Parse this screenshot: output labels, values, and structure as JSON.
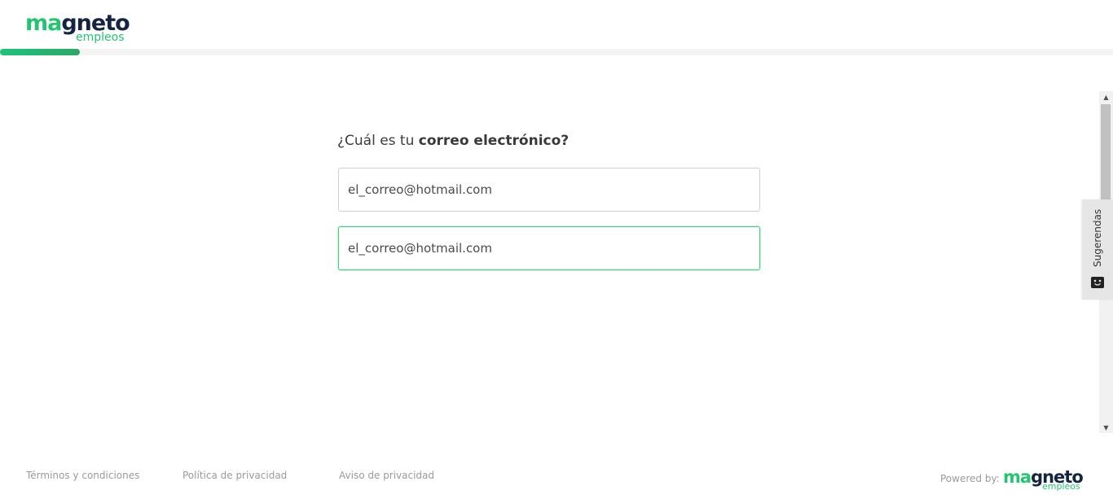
{
  "header": {
    "logo": {
      "word_part1": "ma",
      "word_part2": "gneto",
      "sub": "empleos",
      "colors": {
        "green": "#24c472",
        "navy": "#142441"
      }
    },
    "progress_fraction": 0.072
  },
  "main": {
    "question_prefix": "¿Cuál es tu ",
    "question_bold": "correo electrónico?",
    "email_field_value": "el_correo@hotmail.com",
    "confirm_email_field_value": "el_correo@hotmail.com"
  },
  "sidebar_tab": {
    "label": "Sugerendas",
    "icon": "feedback-face-icon"
  },
  "footer": {
    "links": [
      "Términos y condiciones",
      "Política de privacidad",
      "Aviso de privacidad"
    ],
    "powered_by": "Powered by:",
    "logo": {
      "word_part1": "ma",
      "word_part2": "gneto",
      "sub": "empleos"
    }
  },
  "colors": {
    "accent": "#24c472",
    "focus_border": "#3fd27a",
    "text": "#3c3c3c",
    "muted": "#9a9a9a"
  }
}
